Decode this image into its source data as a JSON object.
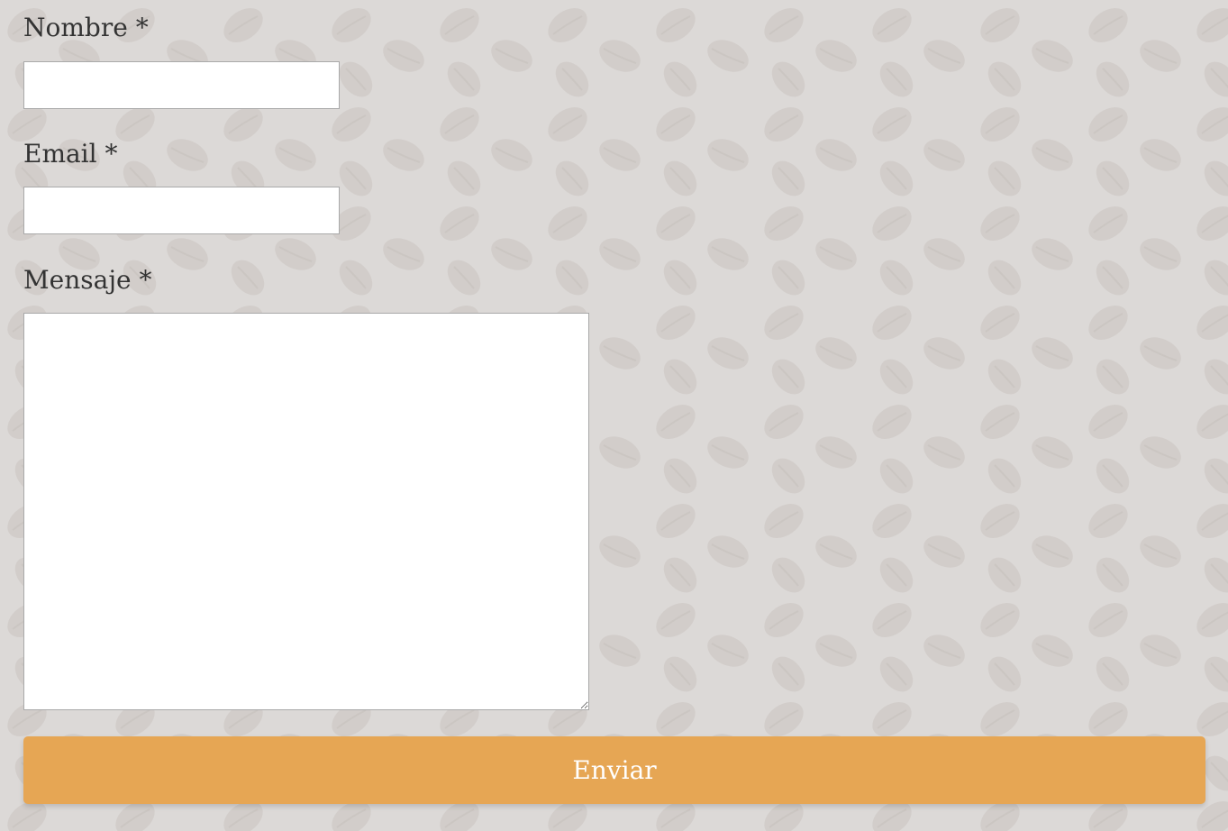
{
  "form": {
    "name_label": "Nombre *",
    "name_value": "",
    "email_label": "Email *",
    "email_value": "",
    "message_label": "Mensaje *",
    "message_value": "",
    "submit_label": "Enviar"
  },
  "colors": {
    "page_background": "#d9d6d4",
    "button_background": "#e6a654",
    "button_text": "#ffffff",
    "label_text": "#333333"
  },
  "background": {
    "image": "coffee-beans-pattern"
  }
}
